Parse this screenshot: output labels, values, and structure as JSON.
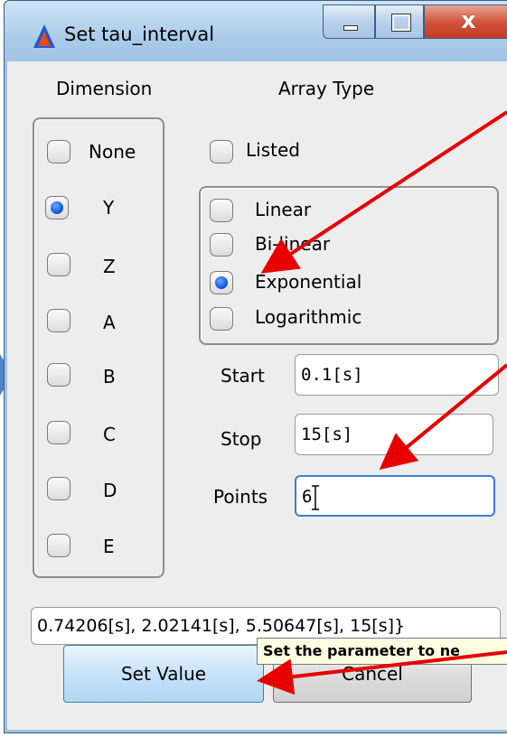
{
  "window": {
    "title": "Set tau_interval"
  },
  "dimension": {
    "heading": "Dimension",
    "options": [
      "None",
      "Y",
      "Z",
      "A",
      "B",
      "C",
      "D",
      "E"
    ],
    "selected": "Y"
  },
  "array_type": {
    "heading": "Array Type",
    "listed_label": "Listed",
    "options": [
      "Linear",
      "Bi-linear",
      "Exponential",
      "Logarithmic"
    ],
    "selected": "Exponential"
  },
  "params": {
    "start_label": "Start",
    "start_value": "0.1[s]",
    "stop_label": "Stop",
    "stop_value": "15[s]",
    "points_label": "Points",
    "points_value": "6"
  },
  "result_text": "0.74206[s], 2.02141[s], 5.50647[s], 15[s]}",
  "tooltip_text": "Set the parameter to ne",
  "buttons": {
    "set_value": "Set Value",
    "cancel": "Cancel"
  },
  "colors": {
    "annotation_arrow": "#e60000",
    "selected_radio": "#0a4fd6",
    "focus_border": "#3d7cd6"
  }
}
